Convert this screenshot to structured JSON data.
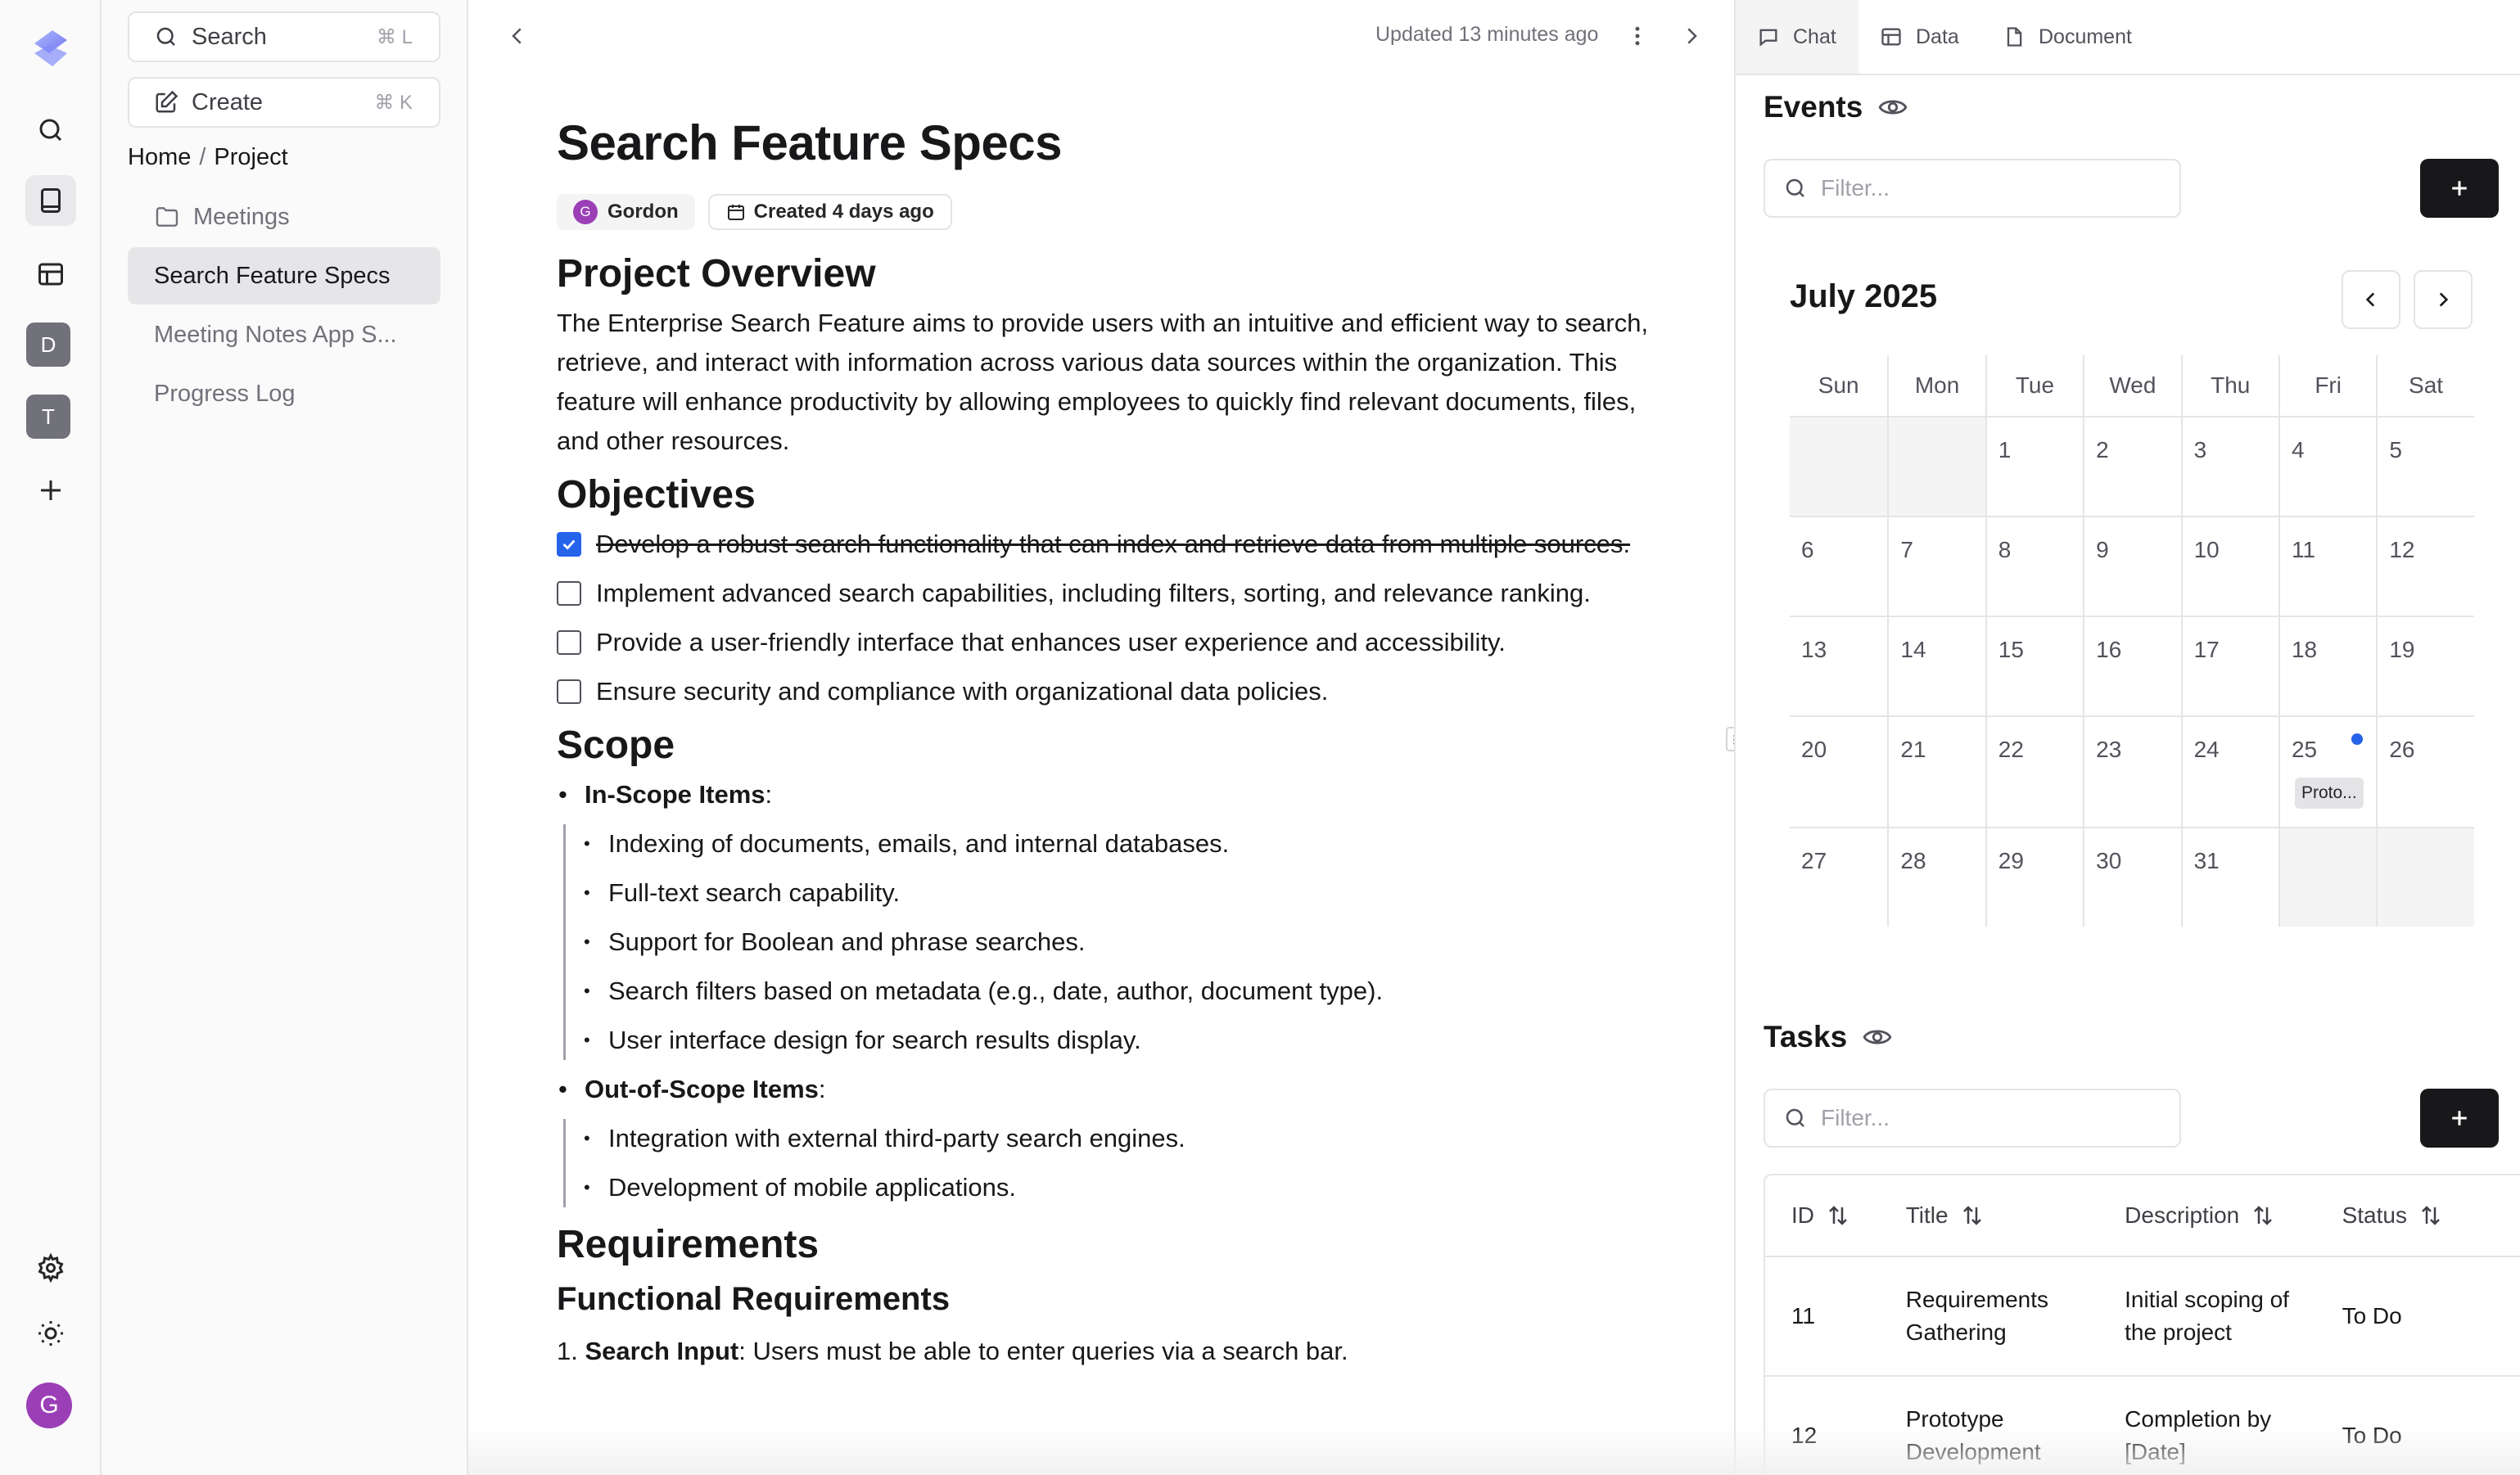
{
  "rail": {
    "letters": [
      "D",
      "T"
    ],
    "avatar": "G"
  },
  "sidebar": {
    "search": {
      "label": "Search",
      "shortcut": "⌘ L"
    },
    "create": {
      "label": "Create",
      "shortcut": "⌘ K"
    },
    "breadcrumb": {
      "home": "Home",
      "sep": "/",
      "current": "Project"
    },
    "items": [
      {
        "label": "Meetings"
      },
      {
        "label": "Search Feature Specs"
      },
      {
        "label": "Meeting Notes App S..."
      },
      {
        "label": "Progress Log"
      }
    ]
  },
  "topbar": {
    "updated": "Updated 13 minutes ago"
  },
  "doc": {
    "title": "Search Feature Specs",
    "author_initial": "G",
    "author": "Gordon",
    "created": "Created 4 days ago",
    "overview_heading": "Project Overview",
    "overview_text": "The Enterprise Search Feature aims to provide users with an intuitive and efficient way to search, retrieve, and interact with information across various data sources within the organization. This feature will enhance productivity by allowing employees to quickly find relevant documents, files, and other resources.",
    "objectives_heading": "Objectives",
    "objectives": [
      {
        "text": "Develop a robust search functionality that can index and retrieve data from multiple sources.",
        "done": true
      },
      {
        "text": "Implement advanced search capabilities, including filters, sorting, and relevance ranking.",
        "done": false
      },
      {
        "text": "Provide a user-friendly interface that enhances user experience and accessibility.",
        "done": false
      },
      {
        "text": "Ensure security and compliance with organizational data policies.",
        "done": false
      }
    ],
    "scope_heading": "Scope",
    "in_scope_label": "In-Scope Items",
    "in_scope": [
      "Indexing of documents, emails, and internal databases.",
      "Full-text search capability.",
      "Support for Boolean and phrase searches.",
      "Search filters based on metadata (e.g., date, author, document type).",
      "User interface design for search results display."
    ],
    "out_scope_label": "Out-of-Scope Items",
    "out_scope": [
      "Integration with external third-party search engines.",
      "Development of mobile applications."
    ],
    "requirements_heading": "Requirements",
    "functional_heading": "Functional Requirements",
    "first_req_num": "1.",
    "first_req_label": "Search Input",
    "first_req_text": ": Users must be able to enter queries via a search bar."
  },
  "panel": {
    "tabs": [
      "Chat",
      "Data",
      "Document"
    ],
    "events": {
      "title": "Events",
      "filter_placeholder": "Filter...",
      "month": "July 2025",
      "weekdays": [
        "Sun",
        "Mon",
        "Tue",
        "Wed",
        "Thu",
        "Fri",
        "Sat"
      ],
      "weeks": [
        [
          "",
          "",
          "1",
          "2",
          "3",
          "4",
          "5"
        ],
        [
          "6",
          "7",
          "8",
          "9",
          "10",
          "11",
          "12"
        ],
        [
          "13",
          "14",
          "15",
          "16",
          "17",
          "18",
          "19"
        ],
        [
          "20",
          "21",
          "22",
          "23",
          "24",
          "25",
          "26"
        ],
        [
          "27",
          "28",
          "29",
          "30",
          "31",
          "",
          ""
        ]
      ],
      "event_label": "Proto...",
      "accent": "#2563eb"
    },
    "tasks": {
      "title": "Tasks",
      "filter_placeholder": "Filter...",
      "columns": [
        "ID",
        "Title",
        "Description",
        "Status"
      ],
      "rows": [
        {
          "id": "11",
          "title": "Requirements Gathering",
          "description": "Initial scoping of the project",
          "status": "To Do"
        },
        {
          "id": "12",
          "title": "Prototype Development",
          "description": "Completion by [Date]",
          "status": "To Do"
        }
      ]
    }
  }
}
